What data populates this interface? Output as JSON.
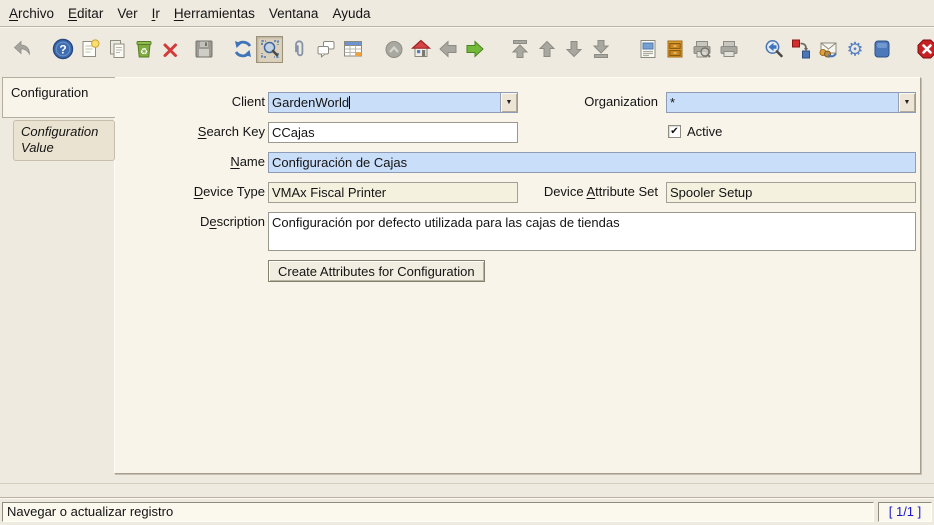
{
  "menu_bar": {
    "items": [
      {
        "label": "Archivo",
        "mnemonic_index": 0
      },
      {
        "label": "Editar",
        "mnemonic_index": 0
      },
      {
        "label": "Ver",
        "mnemonic_index": -1
      },
      {
        "label": "Ir",
        "mnemonic_index": 0
      },
      {
        "label": "Herramientas",
        "mnemonic_index": 0
      },
      {
        "label": "Ventana",
        "mnemonic_index": -1
      },
      {
        "label": "Ayuda",
        "mnemonic_index": -1
      }
    ]
  },
  "toolbar": {
    "items": [
      {
        "name": "undo-icon",
        "state": "disabled"
      },
      {
        "name": "help-icon",
        "state": "enabled"
      },
      {
        "name": "new-record-icon",
        "state": "enabled"
      },
      {
        "name": "copy-record-icon",
        "state": "enabled"
      },
      {
        "name": "delete-record-icon",
        "state": "enabled"
      },
      {
        "name": "delete-selection-icon",
        "state": "enabled"
      },
      {
        "name": "save-icon",
        "state": "disabled"
      },
      {
        "name": "requery-icon",
        "state": "enabled"
      },
      {
        "name": "find-icon",
        "state": "active"
      },
      {
        "name": "attachment-icon",
        "state": "enabled"
      },
      {
        "name": "chat-icon",
        "state": "enabled"
      },
      {
        "name": "grid-toggle-icon",
        "state": "enabled"
      },
      {
        "name": "parent-record-icon",
        "state": "disabled"
      },
      {
        "name": "home-icon",
        "state": "enabled"
      },
      {
        "name": "back-icon",
        "state": "disabled"
      },
      {
        "name": "forward-icon",
        "state": "enabled"
      },
      {
        "name": "first-record-icon",
        "state": "disabled"
      },
      {
        "name": "previous-record-icon",
        "state": "disabled"
      },
      {
        "name": "next-record-icon",
        "state": "disabled"
      },
      {
        "name": "last-record-icon",
        "state": "disabled"
      },
      {
        "name": "report-icon",
        "state": "enabled"
      },
      {
        "name": "archive-icon",
        "state": "enabled"
      },
      {
        "name": "print-preview-icon",
        "state": "disabled"
      },
      {
        "name": "print-icon",
        "state": "disabled"
      },
      {
        "name": "zoom-across-icon",
        "state": "enabled"
      },
      {
        "name": "workflow-icon",
        "state": "enabled"
      },
      {
        "name": "requests-icon",
        "state": "enabled"
      },
      {
        "name": "preferences-icon",
        "state": "enabled"
      },
      {
        "name": "product-info-icon",
        "state": "enabled"
      },
      {
        "name": "exit-icon",
        "state": "enabled"
      }
    ]
  },
  "tabs": [
    {
      "label": "Configuration",
      "active": true
    },
    {
      "label": "Configuration Value",
      "active": false
    }
  ],
  "form": {
    "client": {
      "label": "Client",
      "mnemonic_index": -1,
      "value": "GardenWorld",
      "type": "combo"
    },
    "organization": {
      "label": "Organization",
      "mnemonic_index": -1,
      "value": "*",
      "type": "combo"
    },
    "search_key": {
      "label": "Search Key",
      "mnemonic_index": 0,
      "value": "CCajas"
    },
    "active": {
      "label": "Active",
      "checked": true
    },
    "name": {
      "label": "Name",
      "mnemonic_index": 0,
      "value": "Configuración de Cajas"
    },
    "device_type": {
      "label": "Device Type",
      "mnemonic_index": 0,
      "value": "VMAx Fiscal Printer",
      "readonly": true
    },
    "device_attribute_set": {
      "label": "Device Attribute Set",
      "mnemonic_index": 7,
      "value": "Spooler Setup",
      "readonly": true
    },
    "description": {
      "label": "Description",
      "mnemonic_index": 1,
      "value": "Configuración por defecto utilizada para las cajas de tiendas"
    },
    "create_attributes_button": {
      "label": "Create Attributes for Configuration"
    }
  },
  "status_bar": {
    "message": "Navegar o actualizar registro",
    "record_indicator": "[ 1/1 ]"
  },
  "colors": {
    "window_bg": "#EFEAE0",
    "field_mandatory_bg": "#C9DEF8",
    "field_readonly_bg": "#F4F1DF",
    "record_indicator_text": "#1A18CC",
    "toolbar_active_bg": "#DBD1BC"
  }
}
